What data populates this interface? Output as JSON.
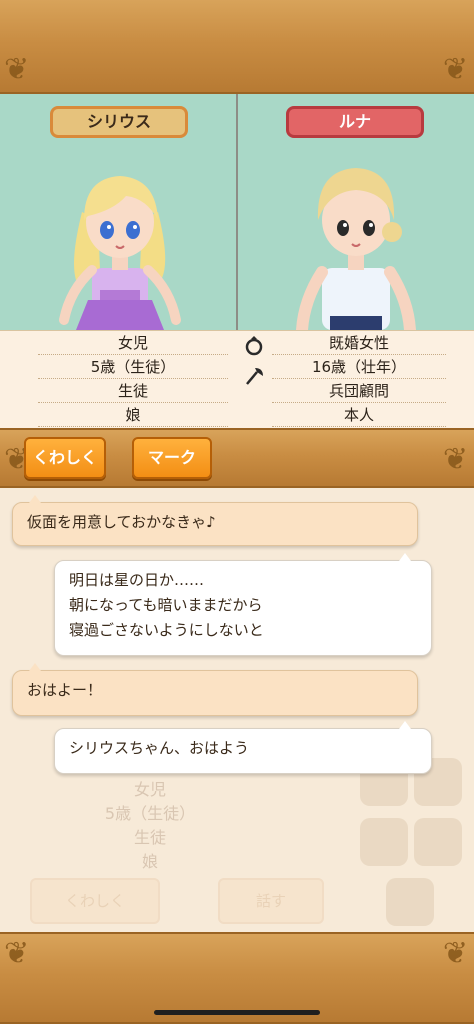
{
  "characters": {
    "left": {
      "name": "シリウス",
      "info": [
        "女児",
        "5歳（生徒）",
        "生徒",
        "娘"
      ]
    },
    "right": {
      "name": "ルナ",
      "info": [
        "既婚女性",
        "16歳（壮年）",
        "兵団顧問",
        "本人"
      ]
    }
  },
  "icons": {
    "ring": "ring-icon",
    "axe": "axe-icon"
  },
  "buttons": {
    "detail": "くわしく",
    "mark": "マーク"
  },
  "chat": [
    {
      "side": "left",
      "text": "仮面を用意しておかなきゃ♪"
    },
    {
      "side": "right",
      "lines": [
        "明日は星の日か……",
        "朝になっても暗いままだから",
        "寝過ごさないようにしないと"
      ]
    },
    {
      "side": "left",
      "text": "おはよー！"
    },
    {
      "side": "right",
      "text": "シリウスちゃん、おはよう"
    }
  ],
  "background_ghost": {
    "info": [
      "女児",
      "5歳（生徒）",
      "生徒",
      "娘"
    ],
    "btn_detail": "くわしく",
    "btn_talk": "話す"
  },
  "colors": {
    "panel_bg": "#a9d8c7",
    "button": "#f38e14",
    "name_left": "#e6c27c",
    "name_right": "#e26566"
  }
}
